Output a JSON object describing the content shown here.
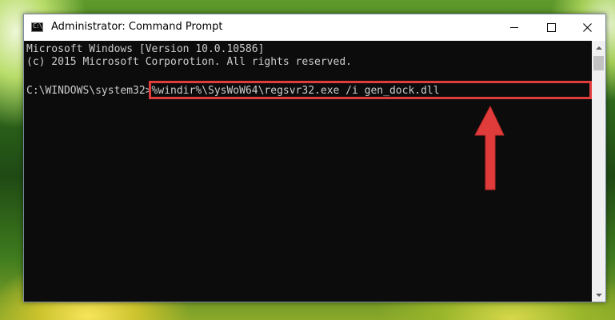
{
  "window": {
    "title": "Administrator: Command Prompt",
    "icon": "cmd-icon",
    "icon_text": "C:\\",
    "controls": [
      "minimize-icon",
      "maximize-icon",
      "close-icon"
    ]
  },
  "console": {
    "line1": "Microsoft Windows [Version 10.0.10586]",
    "line2": "(c) 2015 Microsoft Corporotion. All rights reserved.",
    "prompt": "C:\\WINDOWS\\system32>",
    "command": "%windir%\\SysWoW64\\regsvr32.exe /i gen_dock.dll"
  },
  "annotation": {
    "highlight_color": "#e03c3c",
    "arrow_color": "#e03c3c"
  },
  "colors": {
    "console_bg": "#0c0c0c",
    "console_text": "#cccccc"
  }
}
